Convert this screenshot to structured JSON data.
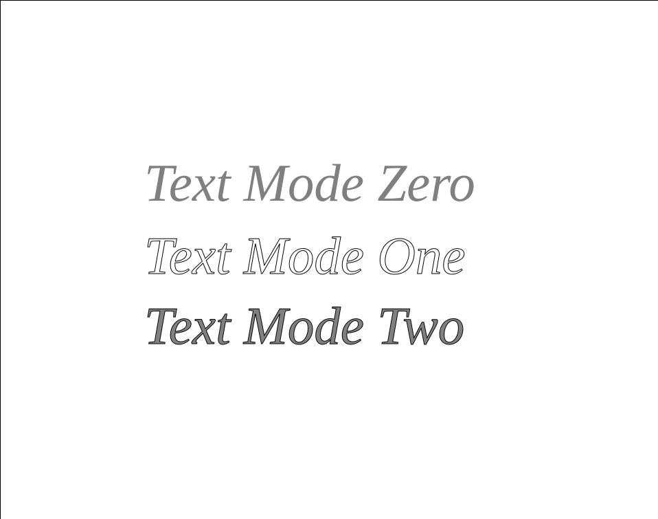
{
  "lines": [
    {
      "text": "Text Mode Zero",
      "mode": "fill"
    },
    {
      "text": "Text Mode One",
      "mode": "stroke"
    },
    {
      "text": "Text Mode Two",
      "mode": "fill-stroke"
    }
  ],
  "colors": {
    "fill": "#808080",
    "stroke": "#000000",
    "background": "#ffffff"
  }
}
